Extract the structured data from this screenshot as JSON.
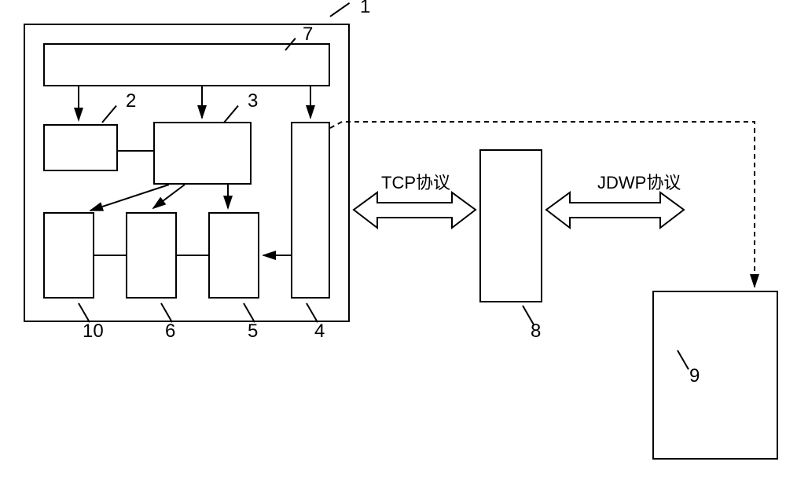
{
  "labels": {
    "container": "1",
    "box2": "2",
    "box3": "3",
    "box4": "4",
    "box5": "5",
    "box6": "6",
    "box7": "7",
    "box8": "8",
    "box9": "9",
    "box10": "10",
    "tcp": "TCP协议",
    "jdwp": "JDWP协议"
  }
}
